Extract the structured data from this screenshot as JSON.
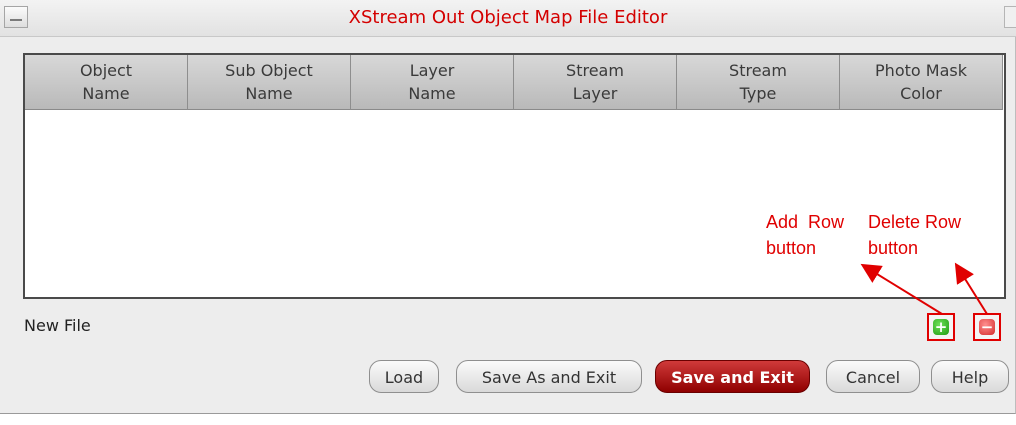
{
  "window": {
    "title": "XStream Out Object Map File Editor",
    "title_color": "#d40000"
  },
  "table": {
    "columns": [
      {
        "line1": "Object",
        "line2": "Name"
      },
      {
        "line1": "Sub Object",
        "line2": "Name"
      },
      {
        "line1": "Layer",
        "line2": "Name"
      },
      {
        "line1": "Stream",
        "line2": "Layer"
      },
      {
        "line1": "Stream",
        "line2": "Type"
      },
      {
        "line1": "Photo Mask",
        "line2": "Color"
      }
    ],
    "rows": []
  },
  "status": {
    "text": "New File"
  },
  "icons": {
    "add": "plus-icon",
    "delete": "minus-icon"
  },
  "buttons": {
    "load": "Load",
    "save_as_exit": "Save As and Exit",
    "save_exit": "Save and Exit",
    "cancel": "Cancel",
    "help": "Help"
  },
  "annotations": {
    "add_line1": "Add  Row",
    "add_line2": "button",
    "delete_line1": "Delete Row",
    "delete_line2": "button",
    "color": "#e00000"
  }
}
